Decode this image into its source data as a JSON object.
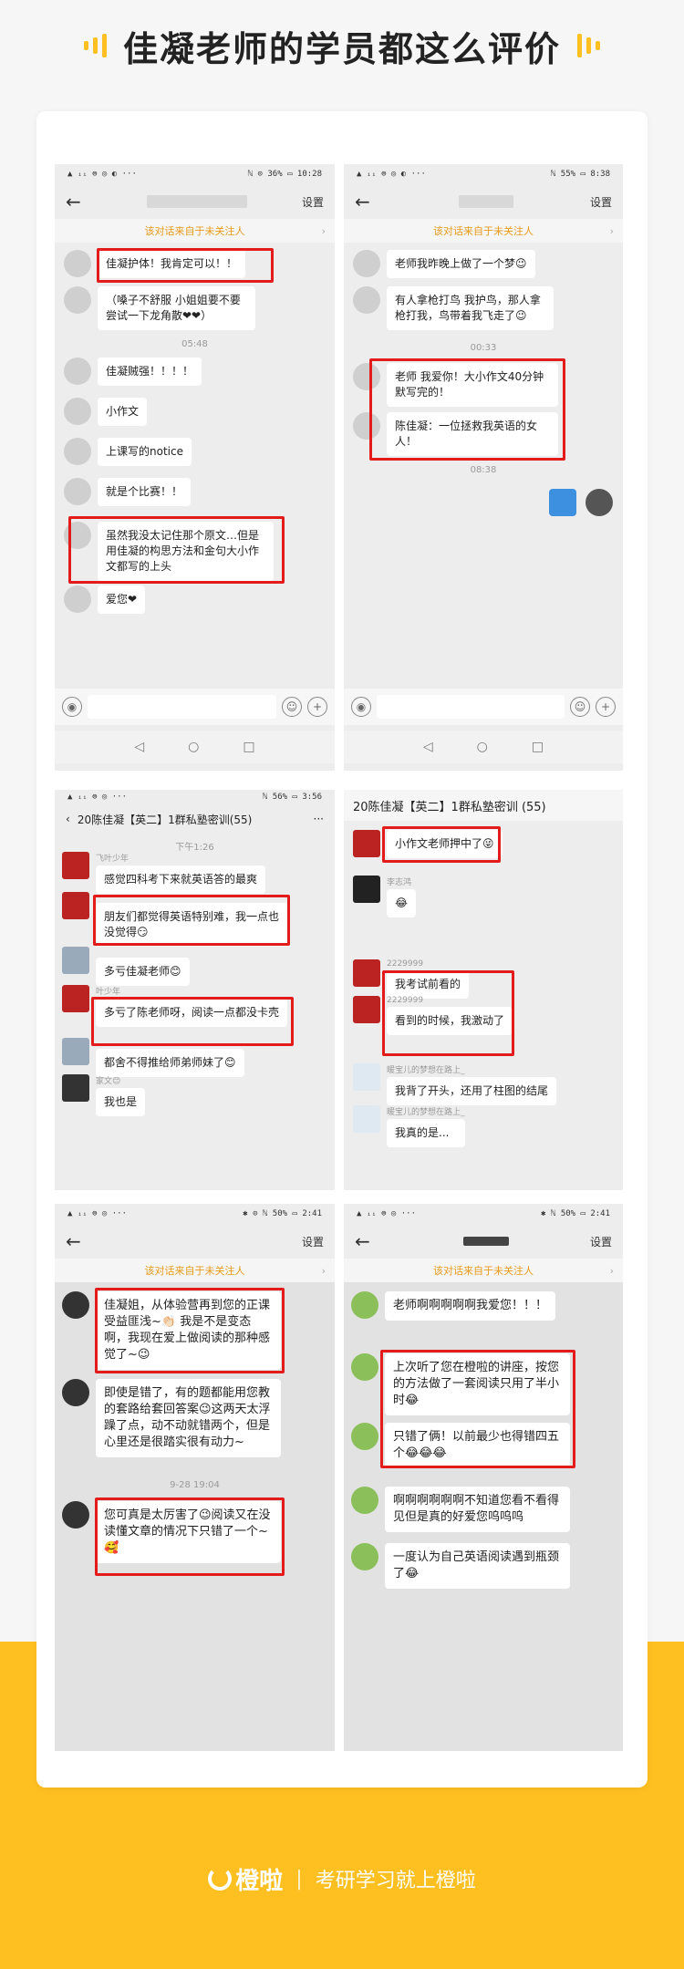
{
  "header": {
    "title": "佳凝老师的学员都这么评价"
  },
  "common": {
    "settings": "设置",
    "warning": "该对话来自于未关注人",
    "back": "←",
    "chevron": "›"
  },
  "shot1": {
    "status_left": "▲ ᵢᵢ ⊜ ◎ ◐ ···",
    "status_right": "ℕ ⊙ 36% ▭ 10:28",
    "messages": [
      "佳凝护体！我肯定可以！！",
      "（嗓子不舒服 小姐姐要不要尝试一下龙角散❤❤）",
      "佳凝贼强！！！！",
      "小作文",
      "上课写的notice",
      "就是个比赛！！",
      "虽然我没太记住那个原文…但是用佳凝的构思方法和金句大小作文都写的上头",
      "爱您❤"
    ],
    "time1": "05:48"
  },
  "shot2": {
    "status_left": "▲ ᵢᵢ ⊜ ◎ ◐ ···",
    "status_right": "ℕ 55% ▭ 8:38",
    "messages": [
      "老师我昨晚上做了一个梦😉",
      "有人拿枪打鸟 我护鸟，那人拿枪打我，鸟带着我飞走了😉",
      "老师 我爱你！大小作文40分钟默写完的！",
      "陈佳凝：一位拯救我英语的女人！"
    ],
    "time1": "00:33",
    "time2": "08:38"
  },
  "shot3": {
    "status_left": "▲ ᵢᵢ ⊜ ◎ ···",
    "status_right": "ℕ 56% ▭ 3:56",
    "group": "20陈佳凝【英二】1群私塾密训(55)",
    "more": "···",
    "time": "下午1:26",
    "nick1": "飞叶少年",
    "nick3": "叶少年",
    "nick5": "家文😊",
    "messages": [
      "感觉四科考下来就英语答的最爽",
      "朋友们都觉得英语特别难，我一点也没觉得😏",
      "多亏佳凝老师😊",
      "多亏了陈老师呀，阅读一点都没卡壳",
      "都舍不得推给师弟师妹了😊",
      "我也是"
    ]
  },
  "shot4": {
    "group": "20陈佳凝【英二】1群私塾密训 (55)",
    "nick_a": "李志鸿",
    "nick_b": "2229999",
    "nick_c": "2229999",
    "nick_d": "暖宝儿的梦想在路上_",
    "nick_e": "暖宝儿的梦想在路上_",
    "messages": [
      "小作文老师押中了😜",
      "😂",
      "我考试前看的",
      "看到的时候，我激动了",
      "我背了开头，还用了柱图的结尾",
      "我真的是..."
    ]
  },
  "shot5": {
    "status_left": "▲ ᵢᵢ ⊜ ◎ ···",
    "status_right": "✱ ⊙ ℕ 50% ▭ 2:41",
    "messages": [
      "佳凝姐，从体验营再到您的正课受益匪浅~👏🏻 我是不是变态啊，我现在爱上做阅读的那种感觉了~😉",
      "即使是错了，有的题都能用您教的套路给套回答案😉这两天太浮躁了点，动不动就错两个，但是心里还是很踏实很有动力~",
      "您可真是太厉害了😉阅读又在没读懂文章的情况下只错了一个~🥰"
    ],
    "time": "9-28 19:04"
  },
  "shot6": {
    "status_left": "▲ ᵢᵢ ⊜ ◎ ···",
    "status_right": "✱ ℕ 50% ▭ 2:41",
    "messages": [
      "老师啊啊啊啊啊我爱您！！！",
      "上次听了您在橙啦的讲座，按您的方法做了一套阅读只用了半小时😂",
      "只错了俩！以前最少也得错四五个😂😂😂",
      "啊啊啊啊啊啊不知道您看不看得见但是真的好爱您呜呜呜",
      "一度认为自己英语阅读遇到瓶颈了😂"
    ]
  },
  "footer": {
    "brand": "橙啦",
    "separator": "|",
    "slogan": "考研学习就上橙啦"
  }
}
